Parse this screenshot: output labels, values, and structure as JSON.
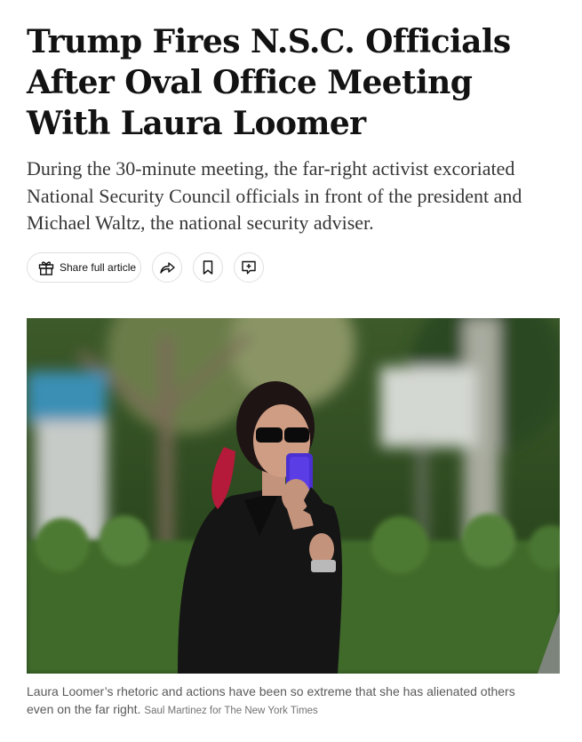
{
  "article": {
    "headline": "Trump Fires N.S.C. Officials After Oval Office Meeting With Laura Loomer",
    "summary": "During the 30-minute meeting, the far-right activist excoriated National Security Council officials in front of the president and Michael Waltz, the national security adviser."
  },
  "actions": {
    "share_label": "Share full article",
    "icons": [
      "gift-icon",
      "share-arrow-icon",
      "bookmark-icon",
      "comment-icon"
    ]
  },
  "photo": {
    "caption": "Laura Loomer’s rhetoric and actions have been so extreme that she has alienated others even on the far right.",
    "credit": "Saul Martinez for The New York Times"
  }
}
